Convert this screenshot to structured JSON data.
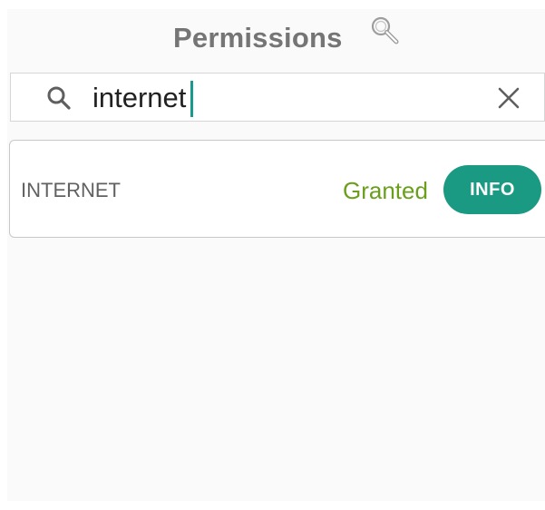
{
  "header": {
    "title": "Permissions"
  },
  "search": {
    "value": "internet"
  },
  "permissions": [
    {
      "name": "INTERNET",
      "status": "Granted",
      "button_label": "INFO"
    }
  ],
  "colors": {
    "accent": "#1a9a82",
    "granted": "#6a9e1b",
    "title": "#757575"
  },
  "icons": {
    "title_icon": "magnifier-icon",
    "search_icon": "search-icon",
    "clear_icon": "close-icon"
  }
}
